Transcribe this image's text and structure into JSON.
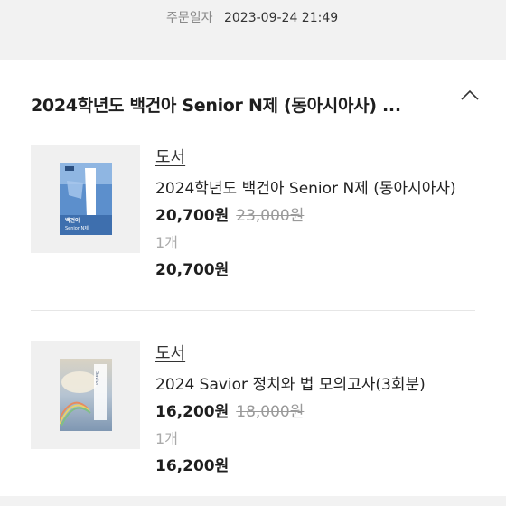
{
  "order_header": {
    "date_label": "주문일자",
    "date_value": "2023-09-24 21:49"
  },
  "order": {
    "title": "2024학년도 백건아 Senior N제 (동아시아사) ...",
    "toggle_icon": "chevron-up-icon"
  },
  "items": [
    {
      "category": "도서",
      "name": "2024학년도 백건아 Senior N제 (동아시아사)",
      "price": "20,700원",
      "original_price": "23,000원",
      "quantity": "1개",
      "total": "20,700원",
      "cover_title": "백건아",
      "cover_subtitle": "Senior N제"
    },
    {
      "category": "도서",
      "name": "2024 Savior 정치와 법 모의고사(3회분)",
      "price": "16,200원",
      "original_price": "18,000원",
      "quantity": "1개",
      "total": "16,200원",
      "cover_title": "Savior"
    }
  ]
}
